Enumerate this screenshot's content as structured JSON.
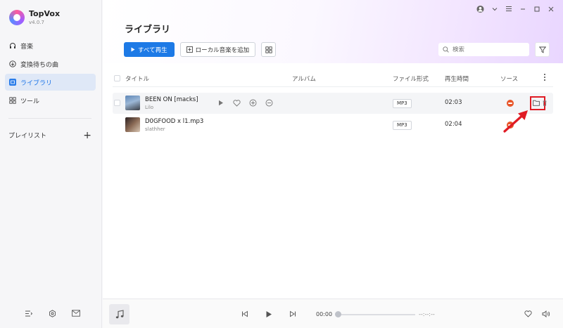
{
  "app": {
    "name": "TopVox",
    "version": "v4.0.7"
  },
  "sidebar": {
    "items": [
      {
        "label": "音楽",
        "icon": "headphones-icon"
      },
      {
        "label": "変換待ちの曲",
        "icon": "download-circle-icon"
      },
      {
        "label": "ライブラリ",
        "icon": "library-icon",
        "active": true
      },
      {
        "label": "ツール",
        "icon": "grid-icon"
      }
    ],
    "playlist_label": "プレイリスト"
  },
  "page": {
    "title": "ライブラリ"
  },
  "toolbar": {
    "play_all_label": "すべて再生",
    "add_local_label": "ローカル音楽を追加"
  },
  "search": {
    "placeholder": "検索"
  },
  "table": {
    "headers": {
      "title": "タイトル",
      "album": "アルバム",
      "format": "ファイル形式",
      "duration": "再生時間",
      "source": "ソース"
    },
    "rows": [
      {
        "title": "BEEN ON [macks]",
        "artist": "Lilo",
        "format": "MP3",
        "duration": "02:03"
      },
      {
        "title": "D0GFOOD x l1.mp3",
        "artist": "slathher",
        "format": "MP3",
        "duration": "02:04"
      }
    ]
  },
  "player": {
    "time_current": "00:00",
    "time_total": "--:--:--"
  },
  "colors": {
    "accent": "#1d7ae6",
    "source": "#e8562a",
    "highlight": "#e01b24"
  }
}
